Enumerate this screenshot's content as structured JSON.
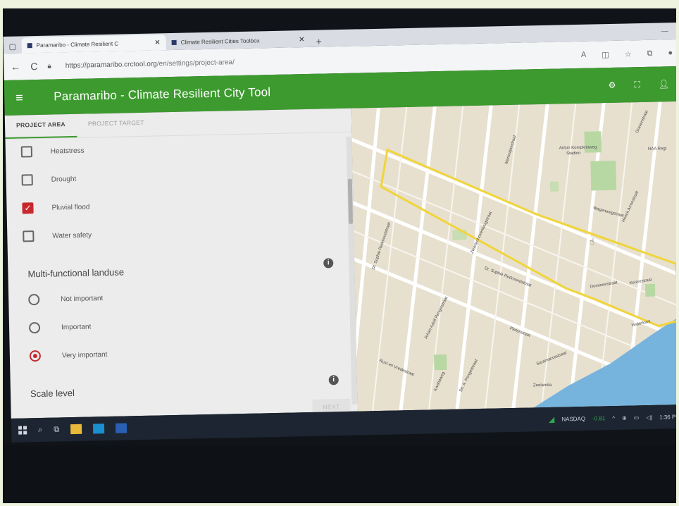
{
  "browser": {
    "tabs": [
      {
        "label": "Paramaribo - Climate Resilient C",
        "active": true
      },
      {
        "label": "Climate Resilient Cities Toolbox",
        "active": false
      }
    ],
    "url_host": "https://paramaribo.crctool.org",
    "url_path": "/en/settings/project-area/"
  },
  "app": {
    "title": "Paramaribo - Climate Resilient City Tool",
    "accent_color": "#3d9a2f",
    "icons": [
      "menu-icon",
      "settings-icon",
      "fullscreen-icon",
      "account-icon"
    ]
  },
  "panel": {
    "tabs": [
      {
        "label": "PROJECT AREA",
        "active": true
      },
      {
        "label": "PROJECT TARGET",
        "active": false
      }
    ],
    "checkboxes": [
      {
        "label": "Heatstress",
        "checked": false
      },
      {
        "label": "Drought",
        "checked": false
      },
      {
        "label": "Pluvial flood",
        "checked": true
      },
      {
        "label": "Water safety",
        "checked": false
      }
    ],
    "multifunctional": {
      "title": "Multi-functional landuse",
      "options": [
        {
          "label": "Not important",
          "selected": false
        },
        {
          "label": "Important",
          "selected": false
        },
        {
          "label": "Very important",
          "selected": true
        }
      ]
    },
    "scale_title": "Scale level",
    "next_label": "NEXT"
  },
  "map": {
    "labels": [
      "Anton Kompleinweg",
      "Stadion",
      "Dr. Sophie Redmondstraat",
      "Pieterstraat",
      "Domineestraat",
      "Keizerstraat",
      "Waterkant",
      "Saramaccastraat",
      "Johan Adolf Pengelstraat",
      "Wagenwegstraat",
      "Zwartenhovenbrugstraat",
      "Dr. Sophie Redmondstraat",
      "Marowijnestraat",
      "Zeelandia",
      "Rust en Vredestraat",
      "Kwattaweg",
      "Gravenstraat",
      "Henck Arronstraat",
      "Sir. A. Pengelstraat",
      "NAA Regt"
    ],
    "area_outline_color": "#f0d53a"
  },
  "taskbar": {
    "ticker": "NASDAQ",
    "ticker_change": "-0.81",
    "time": "1:36 PM"
  }
}
